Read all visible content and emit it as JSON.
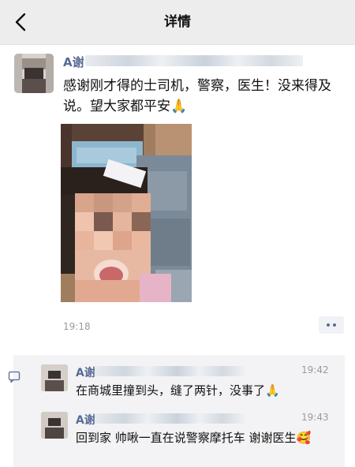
{
  "nav": {
    "title": "详情",
    "back_icon": "chevron-left-icon"
  },
  "post": {
    "username": "A谢",
    "text": "感谢刚才得的士司机，警察，医生！没来得及说。望大家都平安🙏",
    "timestamp": "19:18",
    "photo": "child-photo"
  },
  "comments": [
    {
      "username": "A谢",
      "time": "19:42",
      "text": "在商城里撞到头，缝了两针，没事了🙏"
    },
    {
      "username": "A谢",
      "time": "19:43",
      "text": "回到家 帅啾一直在说警察摩托车 谢谢医生🥰"
    }
  ],
  "colors": {
    "link": "#576b95",
    "nav_bg": "#ededed",
    "comment_bg": "#f3f3f5",
    "meta": "#9a9a9a"
  }
}
